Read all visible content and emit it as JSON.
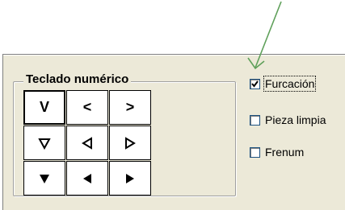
{
  "group": {
    "title": "Teclado numérico",
    "keys": [
      {
        "name": "key-v-letter",
        "label": "V",
        "icon": "letter-v"
      },
      {
        "name": "key-less-than",
        "label": "<",
        "icon": "less-than"
      },
      {
        "name": "key-greater-than",
        "label": ">",
        "icon": "greater-than"
      },
      {
        "name": "key-outline-down",
        "label": "",
        "icon": "outline-triangle-down-icon"
      },
      {
        "name": "key-outline-left",
        "label": "",
        "icon": "outline-triangle-left-icon"
      },
      {
        "name": "key-outline-right",
        "label": "",
        "icon": "outline-triangle-right-icon"
      },
      {
        "name": "key-solid-down",
        "label": "",
        "icon": "solid-triangle-down-icon"
      },
      {
        "name": "key-solid-left",
        "label": "",
        "icon": "solid-triangle-left-icon"
      },
      {
        "name": "key-solid-right",
        "label": "",
        "icon": "solid-triangle-right-icon"
      }
    ]
  },
  "checkboxes": [
    {
      "label": "Furcación",
      "checked": true
    },
    {
      "label": "Pieza limpia",
      "checked": false
    },
    {
      "label": "Frenum",
      "checked": false
    }
  ],
  "annotation": {
    "icon": "pointer-arrow",
    "color": "#5fa05a"
  }
}
